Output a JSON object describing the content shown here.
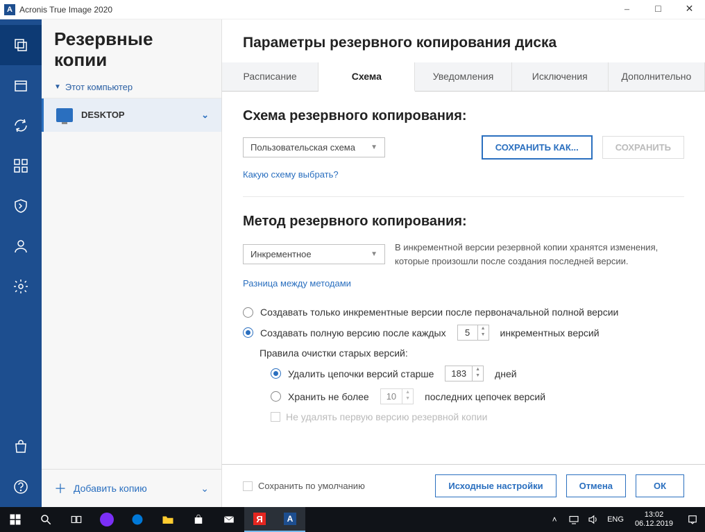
{
  "window": {
    "title": "Acronis True Image 2020"
  },
  "sidebar": {
    "heading": "Резервные копии",
    "filter": "Этот компьютер",
    "item_label": "DESKTOP",
    "add_label": "Добавить копию"
  },
  "content": {
    "title": "Параметры резервного копирования диска",
    "tabs": {
      "schedule": "Расписание",
      "scheme": "Схема",
      "notifications": "Уведомления",
      "exclusions": "Исключения",
      "advanced": "Дополнительно"
    },
    "scheme": {
      "heading": "Схема резервного копирования:",
      "select_value": "Пользовательская схема",
      "save_as": "СОХРАНИТЬ КАК...",
      "save": "СОХРАНИТЬ",
      "help_link": "Какую схему выбрать?"
    },
    "method": {
      "heading": "Метод резервного копирования:",
      "select_value": "Инкрементное",
      "description": "В инкрементной версии резервной копии хранятся изменения, которые произошли после создания последней версии.",
      "diff_link": "Разница между методами",
      "opt_incremental_only": "Создавать только инкрементные версии после первоначальной полной версии",
      "opt_full_prefix": "Создавать полную версию после каждых",
      "opt_full_value": "5",
      "opt_full_suffix": "инкрементных версий",
      "cleanup_heading": "Правила очистки старых версий:",
      "cleanup_age_prefix": "Удалить цепочки версий старше",
      "cleanup_age_value": "183",
      "cleanup_age_suffix": "дней",
      "cleanup_keep_prefix": "Хранить не более",
      "cleanup_keep_value": "10",
      "cleanup_keep_suffix": "последних цепочек версий",
      "cleanup_nodelete": "Не удалять первую версию резервной копии"
    },
    "footer": {
      "save_default": "Сохранить по умолчанию",
      "reset": "Исходные настройки",
      "cancel": "Отмена",
      "ok": "ОК"
    }
  },
  "taskbar": {
    "lang": "ENG",
    "time": "13:02",
    "date": "06.12.2019"
  }
}
